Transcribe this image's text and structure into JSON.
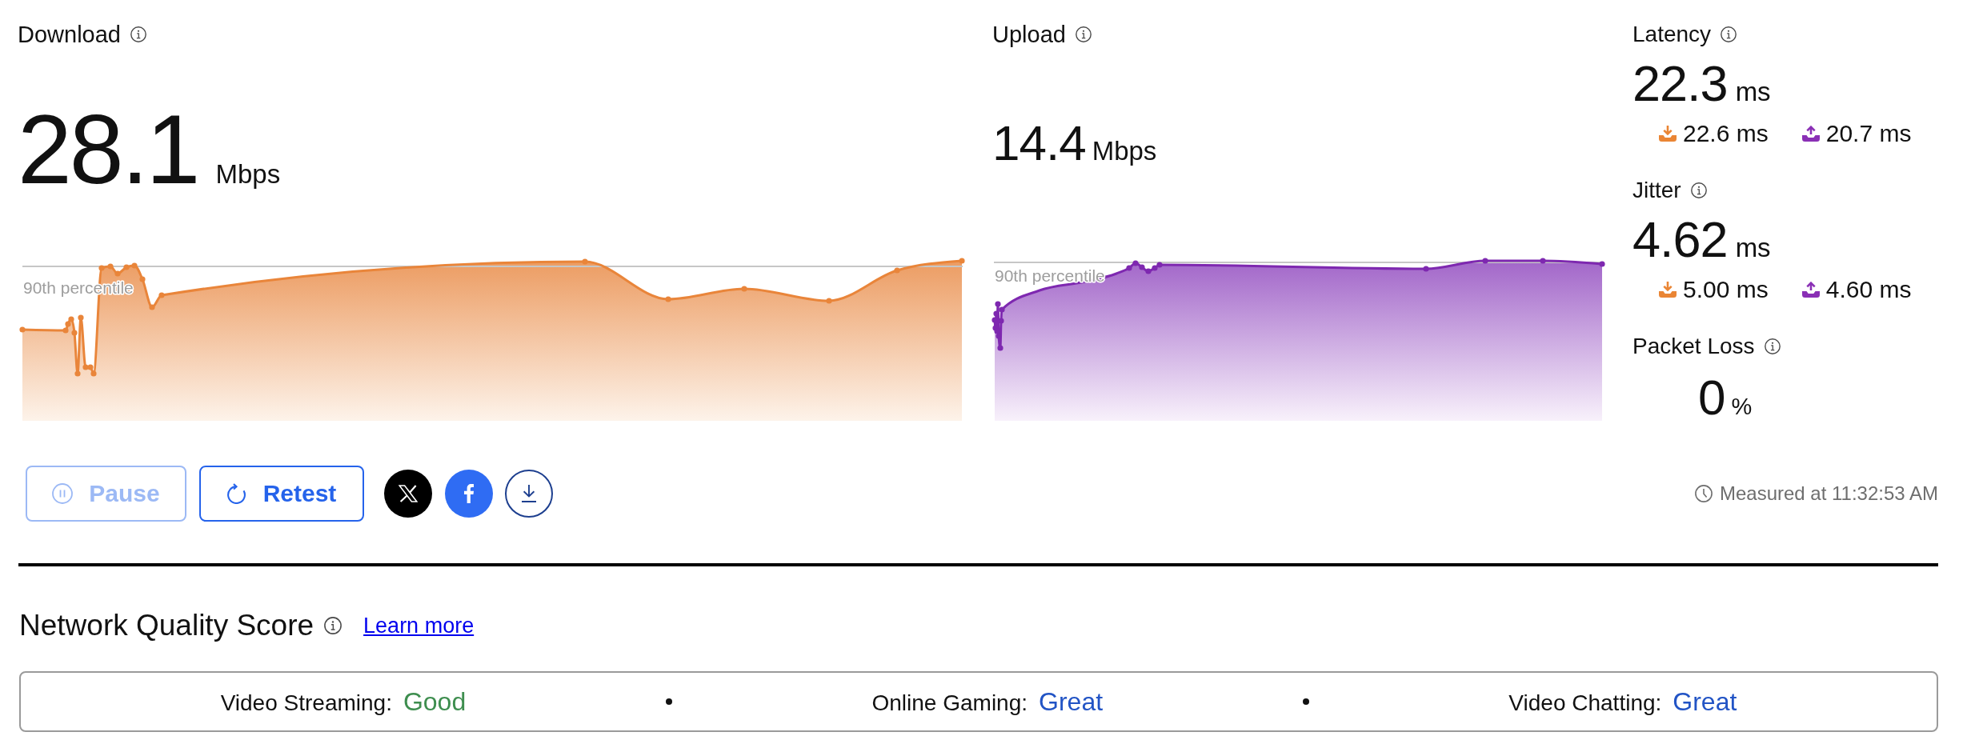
{
  "metrics": [
    {
      "kind": "download",
      "label": "Download",
      "value": "28.1",
      "unit": "Mbps",
      "percentile_label": "90th percentile"
    },
    {
      "kind": "upload",
      "label": "Upload",
      "value": "14.4",
      "unit": "Mbps",
      "percentile_label": "90th percentile"
    }
  ],
  "stats": [
    {
      "label": "Latency",
      "value": "22.3",
      "unit": "ms",
      "readings": [
        {
          "kind": "download",
          "value": "22.6 ms"
        },
        {
          "kind": "upload",
          "value": "20.7 ms"
        }
      ]
    },
    {
      "label": "Jitter",
      "value": "4.62",
      "unit": "ms",
      "readings": [
        {
          "kind": "download",
          "value": "5.00 ms"
        },
        {
          "kind": "upload",
          "value": "4.60 ms"
        }
      ]
    },
    {
      "label": "Packet Loss",
      "value": "0",
      "unit": "%"
    }
  ],
  "controls": [
    {
      "kind": "pause",
      "label": "Pause",
      "disabled": true
    },
    {
      "kind": "retest",
      "label": "Retest",
      "disabled": false
    }
  ],
  "share": [
    {
      "kind": "x"
    },
    {
      "kind": "facebook"
    },
    {
      "kind": "download"
    }
  ],
  "measured_at": "Measured at 11:32:53 AM",
  "score": {
    "title": "Network Quality Score",
    "link": "Learn more",
    "items": [
      {
        "label": "Video Streaming:",
        "rating": "Good",
        "color": "#3e8e4f"
      },
      {
        "label": "Online Gaming:",
        "rating": "Great",
        "color": "#2254c5"
      },
      {
        "label": "Video Chatting:",
        "rating": "Great",
        "color": "#2254c5"
      }
    ]
  }
}
